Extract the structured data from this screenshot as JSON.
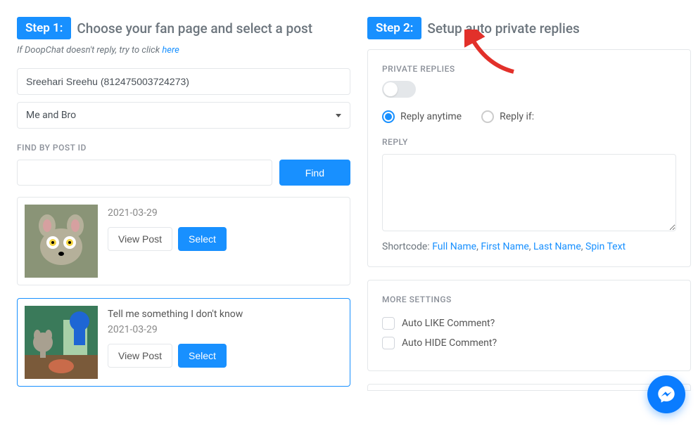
{
  "step1": {
    "badge": "Step 1:",
    "title": "Choose your fan page and select a post",
    "help_prefix": "If DoopChat doesn't reply, try to click ",
    "help_link": "here",
    "page_input_value": "Sreehari Sreehu (812475003724273)",
    "dropdown_value": "Me and Bro",
    "find_label": "FIND BY POST ID",
    "find_button": "Find",
    "posts": [
      {
        "text": "",
        "date": "2021-03-29",
        "view_label": "View Post",
        "select_label": "Select",
        "selected": false
      },
      {
        "text": "Tell me something I don't know",
        "date": "2021-03-29",
        "view_label": "View Post",
        "select_label": "Select",
        "selected": true
      }
    ]
  },
  "step2": {
    "badge": "Step 2:",
    "title": "Setup auto private replies",
    "private_replies_label": "PRIVATE REPLIES",
    "toggle_on": false,
    "radios": {
      "anytime": "Reply anytime",
      "if": "Reply if:"
    },
    "reply_label": "REPLY",
    "shortcode_text": "Shortcode:",
    "shortcodes": [
      "Full Name",
      "First Name",
      "Last Name",
      "Spin Text"
    ],
    "more_settings_label": "MORE SETTINGS",
    "auto_like": "Auto LIKE Comment?",
    "auto_hide": "Auto HIDE Comment?"
  }
}
